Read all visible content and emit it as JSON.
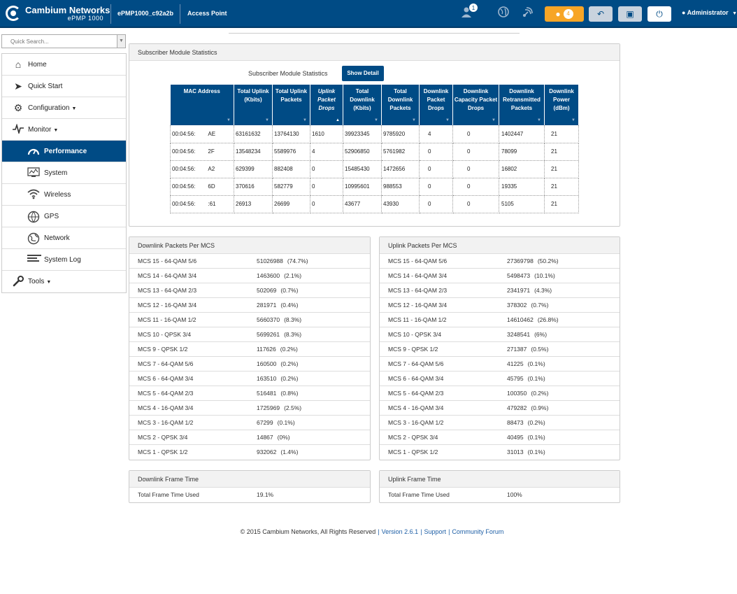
{
  "header": {
    "brand": "Cambium Networks",
    "model": "ePMP 1000",
    "device_name": "ePMP1000_c92a2b",
    "device_mode": "Access Point",
    "user_count": "1",
    "alert_count": "4",
    "user_label": "Administrator",
    "accent": "#004b85"
  },
  "sidebar": {
    "search_placeholder": "Quick Search...",
    "items": [
      {
        "label": "Home",
        "icon": "home-icon"
      },
      {
        "label": "Quick Start",
        "icon": "runner-icon"
      },
      {
        "label": "Configuration",
        "icon": "gear-icon"
      },
      {
        "label": "Monitor",
        "icon": "pulse-icon"
      },
      {
        "label": "Performance",
        "icon": "speedometer-icon"
      },
      {
        "label": "System",
        "icon": "system-icon"
      },
      {
        "label": "Wireless",
        "icon": "wifi-icon"
      },
      {
        "label": "GPS",
        "icon": "gps-globe-icon"
      },
      {
        "label": "Network",
        "icon": "network-globe-icon"
      },
      {
        "label": "System Log",
        "icon": "list-icon"
      },
      {
        "label": "Tools",
        "icon": "wrench-icon"
      }
    ]
  },
  "sm_panel": {
    "title": "Subscriber Module Statistics",
    "subtitle": "Subscriber Module Statistics",
    "show_detail": "Show Detail",
    "columns": [
      "MAC Address",
      "Total Uplink (Kbits)",
      "Total Uplink Packets",
      "Uplink Packet Drops",
      "Total Downlink (Kbits)",
      "Total Downlink Packets",
      "Downlink Packet Drops",
      "Downlink Capacity Packet Drops",
      "Downlink Retransmitted Packets",
      "Downlink Power (dBm)"
    ],
    "rows": [
      {
        "mac_a": "00:04:56:",
        "mac_b": "AE",
        "cells": [
          "63161632",
          "13764130",
          "1610",
          "39923345",
          "9785920",
          "4",
          "0",
          "1402447",
          "21"
        ]
      },
      {
        "mac_a": "00:04:56:",
        "mac_b": "2F",
        "cells": [
          "13548234",
          "5589976",
          "4",
          "52906850",
          "5761982",
          "0",
          "0",
          "78099",
          "21"
        ]
      },
      {
        "mac_a": "00:04:56:",
        "mac_b": "A2",
        "cells": [
          "629399",
          "882408",
          "0",
          "15485430",
          "1472656",
          "0",
          "0",
          "16802",
          "21"
        ]
      },
      {
        "mac_a": "00:04:56:",
        "mac_b": "6D",
        "cells": [
          "370616",
          "582779",
          "0",
          "10995601",
          "988553",
          "0",
          "0",
          "19335",
          "21"
        ]
      },
      {
        "mac_a": "00:04:56:",
        "mac_b": ":61",
        "cells": [
          "26913",
          "26699",
          "0",
          "43677",
          "43930",
          "0",
          "0",
          "5105",
          "21"
        ]
      }
    ]
  },
  "downlink_mcs": {
    "title": "Downlink Packets Per MCS",
    "rows": [
      {
        "label": "MCS 15 - 64-QAM 5/6",
        "value": "51026988",
        "pct": "(74.7%)"
      },
      {
        "label": "MCS 14 - 64-QAM 3/4",
        "value": "1463600",
        "pct": "(2.1%)"
      },
      {
        "label": "MCS 13 - 64-QAM 2/3",
        "value": "502069",
        "pct": "(0.7%)"
      },
      {
        "label": "MCS 12 - 16-QAM 3/4",
        "value": "281971",
        "pct": "(0.4%)"
      },
      {
        "label": "MCS 11 - 16-QAM 1/2",
        "value": "5660370",
        "pct": "(8.3%)"
      },
      {
        "label": "MCS 10 - QPSK 3/4",
        "value": "5699261",
        "pct": "(8.3%)"
      },
      {
        "label": "MCS 9 - QPSK 1/2",
        "value": "117626",
        "pct": "(0.2%)"
      },
      {
        "label": "MCS 7 - 64-QAM 5/6",
        "value": "160500",
        "pct": "(0.2%)"
      },
      {
        "label": "MCS 6 - 64-QAM 3/4",
        "value": "163510",
        "pct": "(0.2%)"
      },
      {
        "label": "MCS 5 - 64-QAM 2/3",
        "value": "516481",
        "pct": "(0.8%)"
      },
      {
        "label": "MCS 4 - 16-QAM 3/4",
        "value": "1725969",
        "pct": "(2.5%)"
      },
      {
        "label": "MCS 3 - 16-QAM 1/2",
        "value": "67299",
        "pct": "(0.1%)"
      },
      {
        "label": "MCS 2 - QPSK 3/4",
        "value": "14867",
        "pct": "(0%)"
      },
      {
        "label": "MCS 1 - QPSK 1/2",
        "value": "932062",
        "pct": "(1.4%)"
      }
    ]
  },
  "uplink_mcs": {
    "title": "Uplink Packets Per MCS",
    "rows": [
      {
        "label": "MCS 15 - 64-QAM 5/6",
        "value": "27369798",
        "pct": "(50.2%)"
      },
      {
        "label": "MCS 14 - 64-QAM 3/4",
        "value": "5498473",
        "pct": "(10.1%)"
      },
      {
        "label": "MCS 13 - 64-QAM 2/3",
        "value": "2341971",
        "pct": "(4.3%)"
      },
      {
        "label": "MCS 12 - 16-QAM 3/4",
        "value": "378302",
        "pct": "(0.7%)"
      },
      {
        "label": "MCS 11 - 16-QAM 1/2",
        "value": "14610462",
        "pct": "(26.8%)"
      },
      {
        "label": "MCS 10 - QPSK 3/4",
        "value": "3248541",
        "pct": "(6%)"
      },
      {
        "label": "MCS 9 - QPSK 1/2",
        "value": "271387",
        "pct": "(0.5%)"
      },
      {
        "label": "MCS 7 - 64-QAM 5/6",
        "value": "41225",
        "pct": "(0.1%)"
      },
      {
        "label": "MCS 6 - 64-QAM 3/4",
        "value": "45795",
        "pct": "(0.1%)"
      },
      {
        "label": "MCS 5 - 64-QAM 2/3",
        "value": "100350",
        "pct": "(0.2%)"
      },
      {
        "label": "MCS 4 - 16-QAM 3/4",
        "value": "479282",
        "pct": "(0.9%)"
      },
      {
        "label": "MCS 3 - 16-QAM 1/2",
        "value": "88473",
        "pct": "(0.2%)"
      },
      {
        "label": "MCS 2 - QPSK 3/4",
        "value": "40495",
        "pct": "(0.1%)"
      },
      {
        "label": "MCS 1 - QPSK 1/2",
        "value": "31013",
        "pct": "(0.1%)"
      }
    ]
  },
  "downlink_frame": {
    "title": "Downlink Frame Time",
    "label": "Total Frame Time Used",
    "value": "19.1%"
  },
  "uplink_frame": {
    "title": "Uplink Frame Time",
    "label": "Total Frame Time Used",
    "value": "100%"
  },
  "footer": {
    "copyright": "© 2015 Cambium Networks, All Rights Reserved",
    "version": "Version 2.6.1",
    "support": "Support",
    "forum": "Community Forum"
  }
}
